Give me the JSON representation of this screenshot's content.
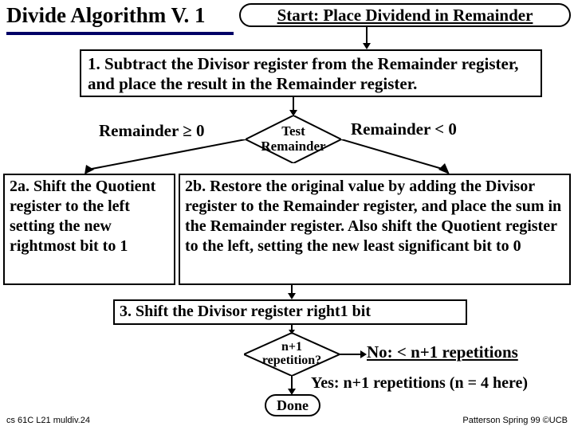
{
  "title": "Divide Algorithm V. 1",
  "start": "Start: Place Dividend in Remainder",
  "step1": "1. Subtract the Divisor register from the Remainder register, and place the result in the Remainder register.",
  "test": {
    "line1": "Test",
    "line2": "Remainder"
  },
  "branch_left": "Remainder ≥ 0",
  "branch_right": "Remainder < 0",
  "step2a": "2a. Shift the Quotient register to the left setting the new rightmost bit to 1",
  "step2b": "2b. Restore the original value by adding the Divisor register to the Remainder register, and place the sum in the Remainder register. Also shift the Quotient register to the left, setting the new least significant bit to 0",
  "step3": "3. Shift the Divisor register right1 bit",
  "rep": {
    "line1": "n+1",
    "line2": "repetition?"
  },
  "no_label": "No: < n+1 repetitions",
  "yes_label": "Yes: n+1 repetitions (n = 4 here)",
  "done": "Done",
  "footer_left": "cs 61C L21 muldiv.24",
  "footer_right": "Patterson Spring 99 ©UCB"
}
